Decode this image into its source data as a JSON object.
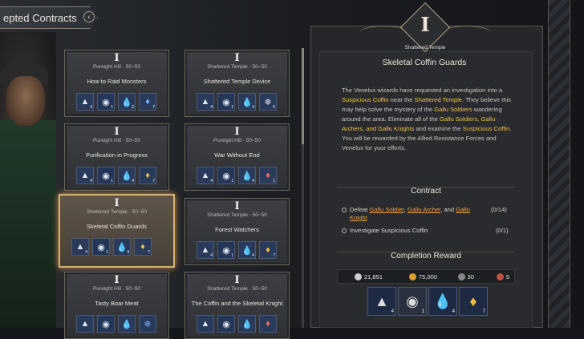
{
  "header": {
    "tab_label": "epted Contracts"
  },
  "cards": [
    {
      "rn": "I",
      "loc": "Pureight Hill  ·  50~50",
      "title": "How to Raid Monsters",
      "rewards": [
        {
          "icon": "▲",
          "q": "4"
        },
        {
          "icon": "◉",
          "q": "1"
        },
        {
          "icon": "💧",
          "q": "2"
        },
        {
          "icon": "♦",
          "q": "7",
          "c": "b"
        }
      ]
    },
    {
      "rn": "I",
      "loc": "Shattered Temple  ·  50~50",
      "title": "Shattered Temple Device",
      "rewards": [
        {
          "icon": "▲",
          "q": "4"
        },
        {
          "icon": "◉",
          "q": "1"
        },
        {
          "icon": "💧",
          "q": "4"
        },
        {
          "icon": "❄",
          "q": "5"
        }
      ]
    },
    {
      "rn": "I",
      "loc": "Pureight Hill  ·  50~50",
      "title": "Purification in Progress",
      "rewards": [
        {
          "icon": "▲",
          "q": "4"
        },
        {
          "icon": "◉",
          "q": "1"
        },
        {
          "icon": "💧",
          "q": "4"
        },
        {
          "icon": "♦",
          "q": "7",
          "c": "y"
        }
      ]
    },
    {
      "rn": "I",
      "loc": "Pureight Hill  ·  50~50",
      "title": "War Without End",
      "rewards": [
        {
          "icon": "▲",
          "q": "4"
        },
        {
          "icon": "◉",
          "q": "1"
        },
        {
          "icon": "💧",
          "q": "4"
        },
        {
          "icon": "♦",
          "q": "1",
          "c": "r"
        }
      ]
    },
    {
      "rn": "I",
      "loc": "Shattered Temple  ·  50~50",
      "title": "Skeletal Coffin Guards",
      "rewards": [
        {
          "icon": "▲",
          "q": "4"
        },
        {
          "icon": "◉",
          "q": "1"
        },
        {
          "icon": "💧",
          "q": "4"
        },
        {
          "icon": "♦",
          "q": "7",
          "c": "y"
        }
      ]
    },
    {
      "rn": "I",
      "loc": "Shattered Temple  ·  50~50",
      "title": "Forest Watchers",
      "rewards": [
        {
          "icon": "▲",
          "q": "4"
        },
        {
          "icon": "◉",
          "q": "1"
        },
        {
          "icon": "💧",
          "q": "4"
        },
        {
          "icon": "♦",
          "q": "7",
          "c": "y"
        }
      ]
    },
    {
      "rn": "I",
      "loc": "Pureight Hill  ·  50~50",
      "title": "Tasty Boar Meat",
      "rewards": [
        {
          "icon": "▲",
          "q": ""
        },
        {
          "icon": "◉",
          "q": ""
        },
        {
          "icon": "💧",
          "q": ""
        },
        {
          "icon": "❄",
          "q": "",
          "c": "b"
        }
      ]
    },
    {
      "rn": "I",
      "loc": "Shattered Temple  ·  50~50",
      "title": "The Coffin and the Skeletal Knight",
      "rewards": [
        {
          "icon": "▲",
          "q": ""
        },
        {
          "icon": "◉",
          "q": ""
        },
        {
          "icon": "💧",
          "q": ""
        },
        {
          "icon": "♦",
          "q": "",
          "c": "r"
        }
      ]
    }
  ],
  "detail": {
    "rank": "I",
    "tag": "Shattered Temple",
    "title": "Skeletal Coffin Guards",
    "desc_parts": [
      {
        "t": "The Venelux wizards have requested an investigation into a "
      },
      {
        "t": "Suspicious Coffin",
        "h": 1
      },
      {
        "t": " near the "
      },
      {
        "t": "Shattered Temple",
        "h": 1
      },
      {
        "t": ". They believe this may help solve the mystery of the "
      },
      {
        "t": "Gallu Soldiers",
        "h": 1
      },
      {
        "t": " wandering around the area. Eliminate all of the "
      },
      {
        "t": "Gallu Soldiers, Gallu Archers, and Gallu Knights",
        "h": 1
      },
      {
        "t": " and examine the "
      },
      {
        "t": "Suspicious Coffin",
        "h": 1
      },
      {
        "t": ". You will be rewarded by the Allied Resistance Forces and Venelux for your efforts."
      }
    ],
    "contract_heading": "Contract",
    "obj1_prefix": "Defeat ",
    "obj1_a": "Gallu Soldier",
    "obj1_sep1": ", ",
    "obj1_b": "Gallu Archer",
    "obj1_sep2": ", and ",
    "obj1_c": "Gallu",
    "obj1_d": "Knight",
    "obj1_progress": "(0/14)",
    "obj2": "Investigate Suspicious Coffin",
    "obj2_progress": "(0/1)",
    "reward_heading": "Completion Reward",
    "currency": [
      "21,851",
      "75,000",
      "30",
      "5"
    ],
    "big_rewards": [
      {
        "icon": "▲",
        "q": "4"
      },
      {
        "icon": "◉",
        "q": "1"
      },
      {
        "icon": "💧",
        "q": "4"
      },
      {
        "icon": "♦",
        "q": "7"
      }
    ]
  },
  "colors": {
    "highlight": "#f0c040",
    "accent": "#d8b070"
  }
}
